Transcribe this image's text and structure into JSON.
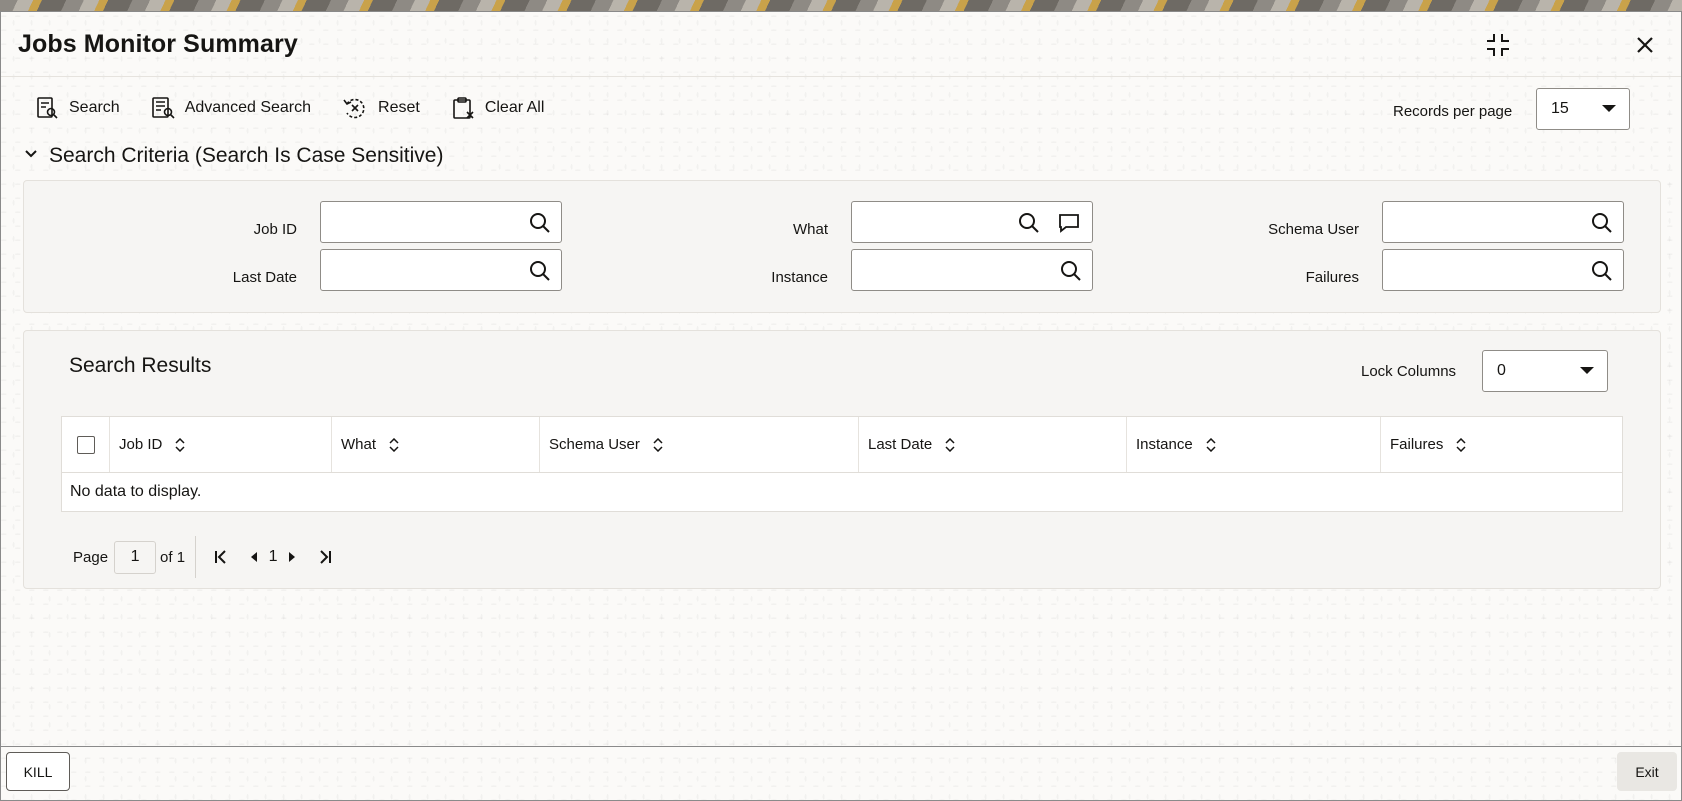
{
  "window": {
    "title": "Jobs Monitor Summary"
  },
  "toolbar": {
    "search_label": "Search",
    "advanced_search_label": "Advanced Search",
    "reset_label": "Reset",
    "clear_all_label": "Clear All",
    "records_per_page_label": "Records per page",
    "records_per_page_value": "15"
  },
  "criteria": {
    "header": "Search Criteria (Search Is Case Sensitive)",
    "fields": {
      "job_id": {
        "label": "Job ID",
        "value": ""
      },
      "what": {
        "label": "What",
        "value": ""
      },
      "schema_user": {
        "label": "Schema User",
        "value": ""
      },
      "last_date": {
        "label": "Last Date",
        "value": ""
      },
      "instance": {
        "label": "Instance",
        "value": ""
      },
      "failures": {
        "label": "Failures",
        "value": ""
      }
    }
  },
  "results": {
    "title": "Search Results",
    "lock_columns_label": "Lock Columns",
    "lock_columns_value": "0",
    "columns": [
      "Job ID",
      "What",
      "Schema User",
      "Last Date",
      "Instance",
      "Failures"
    ],
    "no_data": "No data to display.",
    "pager": {
      "page_label": "Page",
      "current_page": "1",
      "of_label": "of 1",
      "page_number": "1"
    }
  },
  "footer": {
    "kill_label": "KILL",
    "exit_label": "Exit"
  },
  "icons": {
    "restore": "collapse-arrows-icon",
    "close": "close-icon",
    "search": "search-doc-icon",
    "advanced_search": "advanced-search-icon",
    "reset": "reset-icon",
    "clear_all": "clipboard-clear-icon",
    "lookup": "magnifier-icon",
    "comment": "speech-bubble-icon",
    "sort": "sort-updown-icon"
  }
}
